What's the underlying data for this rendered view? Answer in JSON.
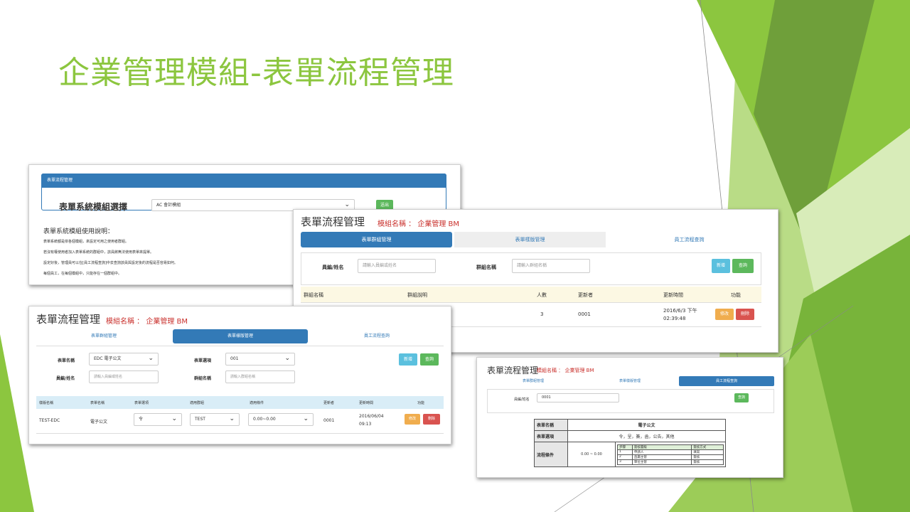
{
  "slide_title": "企業管理模組-表單流程管理",
  "theme": {
    "accent": "#8cc63f",
    "primary": "#337ab7",
    "danger_text": "#c9302c"
  },
  "shot1": {
    "panel_title": "表單流程管理",
    "module_label": "表單系統模組選擇",
    "module_value": "AC 會計模組",
    "submit_label": "送出",
    "usage_title": "表單系統模組使用說明：",
    "usage_lines": [
      "表單系統都是依各個模組，來設定可用之使用者群組。",
      "若沒有權使用者加入表單系統的群組中，該員將無法使用表單來提單。",
      "設定好後，管理員可以在[員工流程查詢]中去查詢該員與設定後的流程是否容易如何。",
      "每個員工，在每個模組中，只能存在一個群組中。"
    ]
  },
  "shot2": {
    "title": "表單流程管理",
    "module_name_label": "模組名稱 ： 企業管理 BM",
    "tabs": [
      "表單群組管理",
      "表單樣版管理",
      "員工流程查詢"
    ],
    "employee_label": "員編/姓名",
    "employee_placeholder": "請輸入員編或姓名",
    "group_label": "群組名稱",
    "group_placeholder": "請輸入群組名稱",
    "add_label": "新增",
    "query_label": "查詢",
    "columns": [
      "群組名稱",
      "群組說明",
      "人數",
      "更新者",
      "更新時間",
      "功能"
    ],
    "row": {
      "count": "3",
      "updater": "0001",
      "time_line1": "2016/6/3 下午",
      "time_line2": "02:39:48"
    },
    "edit_label": "修改",
    "delete_label": "刪除"
  },
  "shot3": {
    "title": "表單流程管理",
    "module_name_label": "模組名稱 ： 企業管理 BM",
    "tabs": [
      "表單群組管理",
      "表單樣版管理",
      "員工流程查詢"
    ],
    "form_name_label": "表單名稱",
    "form_name_value": "EDC 電子公文",
    "form_option_label": "表單選項",
    "form_option_value": "001",
    "employee_label": "員編/姓名",
    "employee_placeholder": "請輸入員編或姓名",
    "group_label": "群組名稱",
    "group_placeholder": "請輸入群組名稱",
    "add_label": "新增",
    "query_label": "查詢",
    "columns": [
      "樣版名稱",
      "表單名稱",
      "表單選項",
      "適用群組",
      "適用條件",
      "更新者",
      "更新時間",
      "功能"
    ],
    "row": {
      "template": "TEST-EDC",
      "form_name": "電子公文",
      "option": "令",
      "group": "TEST",
      "condition": "0.00~0.00",
      "updater": "0001",
      "time_line1": "2016/06/04",
      "time_line2": "09:13"
    },
    "edit_label": "修改",
    "delete_label": "刪除"
  },
  "shot4": {
    "title": "表單流程管理",
    "module_name_label": "模組名稱 ： 企業管理 BM",
    "tabs": [
      "表單群組管理",
      "表單樣版管理",
      "員工流程查詢"
    ],
    "employee_label": "員編/姓名",
    "employee_value": "0001",
    "query_label": "查詢",
    "doc": {
      "form_name_label": "表單名稱",
      "form_name_value": "電子公文",
      "form_option_label": "表單選項",
      "form_option_value": "令，呈，簽，函，公告，其他",
      "flow_label": "流程條件",
      "flow_range": "0.00 ~ 0.00",
      "flow_header": [
        "步驟",
        "簽核層級",
        "簽核方式"
      ],
      "flow_rows": [
        [
          "1",
          "申請人",
          "填寫"
        ],
        [
          "2",
          "直屬主管",
          "簽核"
        ],
        [
          "3",
          "單位主管",
          "簽核"
        ]
      ]
    }
  }
}
